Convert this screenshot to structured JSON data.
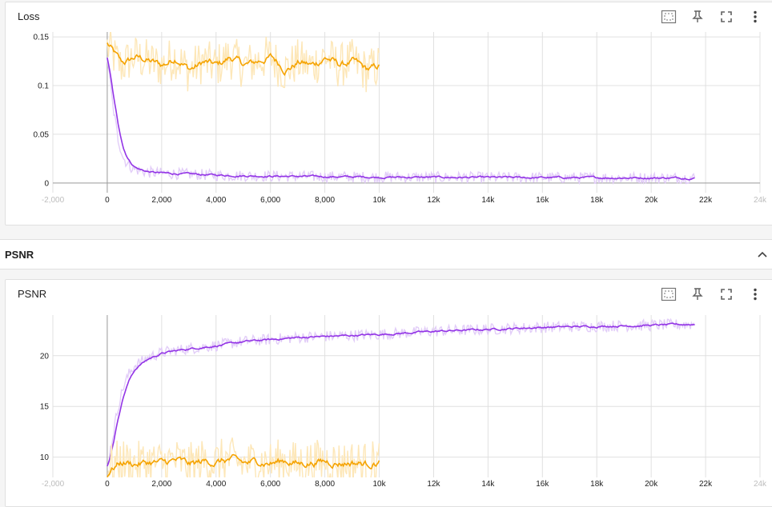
{
  "loss_card": {
    "title": "Loss",
    "toolbar": {
      "fit_icon": "fit-domain-icon",
      "pin_icon": "pin-icon",
      "fullscreen_icon": "fullscreen-icon",
      "menu_icon": "more-vert-icon"
    }
  },
  "group": {
    "title": "PSNR",
    "toggle_icon": "chevron-up-icon"
  },
  "psnr_card": {
    "title": "PSNR",
    "toolbar": {
      "fit_icon": "fit-domain-icon",
      "pin_icon": "pin-icon",
      "fullscreen_icon": "fullscreen-icon",
      "menu_icon": "more-vert-icon"
    }
  },
  "colors": {
    "orange": "#f5a300",
    "orange_light": "#fde7b8",
    "purple": "#9334e6",
    "purple_light": "#e2cdf8",
    "grid": "#e0e0e0",
    "axis": "#9e9e9e"
  },
  "chart_data": [
    {
      "type": "line",
      "title": "Loss",
      "xlabel": "",
      "ylabel": "",
      "xlim": [
        -2000,
        24000
      ],
      "ylim": [
        -0.01,
        0.155
      ],
      "grid": true,
      "x_ticks": [
        "-2,000",
        "0",
        "2,000",
        "4,000",
        "6,000",
        "8,000",
        "10k",
        "12k",
        "14k",
        "16k",
        "18k",
        "20k",
        "22k",
        "24k"
      ],
      "x_tick_values": [
        -2000,
        0,
        2000,
        4000,
        6000,
        8000,
        10000,
        12000,
        14000,
        16000,
        18000,
        20000,
        22000,
        24000
      ],
      "y_ticks": [
        "0",
        "0.05",
        "0.1",
        "0.15"
      ],
      "y_tick_values": [
        0,
        0.05,
        0.1,
        0.15
      ],
      "series": [
        {
          "color": "orange",
          "x": [
            0,
            500,
            1000,
            1500,
            2000,
            2500,
            3000,
            3500,
            4000,
            4500,
            5000,
            5500,
            6000,
            6500,
            7000,
            7500,
            8000,
            8500,
            9000,
            9500,
            10000
          ],
          "y": [
            0.14,
            0.12,
            0.13,
            0.125,
            0.12,
            0.13,
            0.115,
            0.125,
            0.12,
            0.13,
            0.12,
            0.125,
            0.13,
            0.115,
            0.125,
            0.12,
            0.13,
            0.12,
            0.125,
            0.115,
            0.12
          ]
        },
        {
          "color": "purple",
          "x": [
            0,
            200,
            400,
            600,
            800,
            1000,
            1500,
            2000,
            3000,
            4000,
            5000,
            6000,
            8000,
            10000,
            12000,
            14000,
            16000,
            18000,
            20000,
            21600
          ],
          "y": [
            0.13,
            0.08,
            0.045,
            0.025,
            0.018,
            0.014,
            0.011,
            0.01,
            0.009,
            0.008,
            0.0075,
            0.007,
            0.0065,
            0.006,
            0.0058,
            0.0056,
            0.0055,
            0.0054,
            0.0053,
            0.0052
          ]
        }
      ]
    },
    {
      "type": "line",
      "title": "PSNR",
      "xlabel": "",
      "ylabel": "",
      "xlim": [
        -2000,
        24000
      ],
      "ylim": [
        8.0,
        24.0
      ],
      "grid": true,
      "x_ticks": [
        "-2,000",
        "0",
        "2,000",
        "4,000",
        "6,000",
        "8,000",
        "10k",
        "12k",
        "14k",
        "16k",
        "18k",
        "20k",
        "22k",
        "24k"
      ],
      "x_tick_values": [
        -2000,
        0,
        2000,
        4000,
        6000,
        8000,
        10000,
        12000,
        14000,
        16000,
        18000,
        20000,
        22000,
        24000
      ],
      "y_ticks": [
        "10",
        "15",
        "20"
      ],
      "y_tick_values": [
        10,
        15,
        20
      ],
      "series": [
        {
          "color": "purple",
          "x": [
            0,
            200,
            400,
            600,
            800,
            1000,
            1500,
            2000,
            3000,
            4000,
            5000,
            6000,
            7000,
            8000,
            9000,
            10000,
            12000,
            14000,
            16000,
            18000,
            20000,
            21600
          ],
          "y": [
            9.0,
            12.0,
            15.0,
            17.0,
            18.2,
            19.0,
            19.8,
            20.3,
            20.7,
            21.0,
            21.4,
            21.6,
            21.8,
            21.9,
            22.0,
            22.1,
            22.4,
            22.6,
            22.8,
            22.9,
            23.0,
            23.1
          ]
        },
        {
          "color": "orange",
          "x": [
            0,
            500,
            1000,
            1500,
            2000,
            2500,
            3000,
            3500,
            4000,
            4500,
            5000,
            5500,
            6000,
            6500,
            7000,
            7500,
            8000,
            8500,
            9000,
            9500,
            10000
          ],
          "y": [
            9.0,
            9.6,
            9.3,
            9.5,
            9.4,
            9.7,
            9.2,
            9.6,
            9.5,
            9.8,
            9.3,
            9.6,
            9.4,
            9.7,
            9.3,
            9.5,
            9.6,
            9.4,
            9.5,
            9.3,
            9.6
          ]
        }
      ]
    }
  ]
}
